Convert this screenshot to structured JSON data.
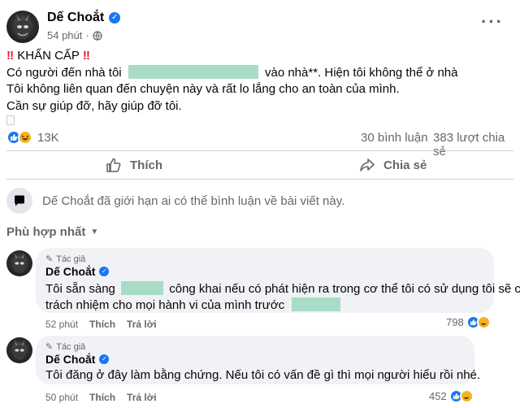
{
  "post": {
    "author": "Dế Choắt",
    "time": "54 phút",
    "line1_prefix": "KHẨN CẤP",
    "line2_a": "Có người đến nhà tôi",
    "line2_b": "vào nhà**. Hiện tôi không thể ở nhà",
    "line3": "Tôi không liên quan đến chuyện này và rất lo lắng cho an toàn của mình.",
    "line4": "Cần sự giúp đỡ, hãy giúp đỡ tôi."
  },
  "stats": {
    "reactions": "13K",
    "comments": "30 bình luận",
    "shares": "383 lượt chia sẻ"
  },
  "actions": {
    "like": "Thích",
    "share": "Chia sẻ"
  },
  "notice": "Dế Choắt đã giới hạn ai có thể bình luận về bài viết này.",
  "sort": "Phù hợp nhất",
  "comments": [
    {
      "badge": "Tác giả",
      "name": "Dế Choắt",
      "line1_a": "Tôi sẵn sàng",
      "line1_b": "công khai nếu có phát hiện ra trong cơ thể tôi có sử dụng tôi sẽ chịu",
      "line2": "trách nhiệm cho mọi hành vi của mình trước",
      "time": "52 phút",
      "like": "Thích",
      "reply": "Trả lời",
      "count": "798"
    },
    {
      "badge": "Tác giả",
      "name": "Dế Choắt",
      "line1": "Tôi đăng ở đây làm bằng chứng. Nếu tôi có vấn đề gì thì mọi người hiểu rồi nhé.",
      "time": "50 phút",
      "like": "Thích",
      "reply": "Trả lời",
      "count": "452"
    }
  ]
}
